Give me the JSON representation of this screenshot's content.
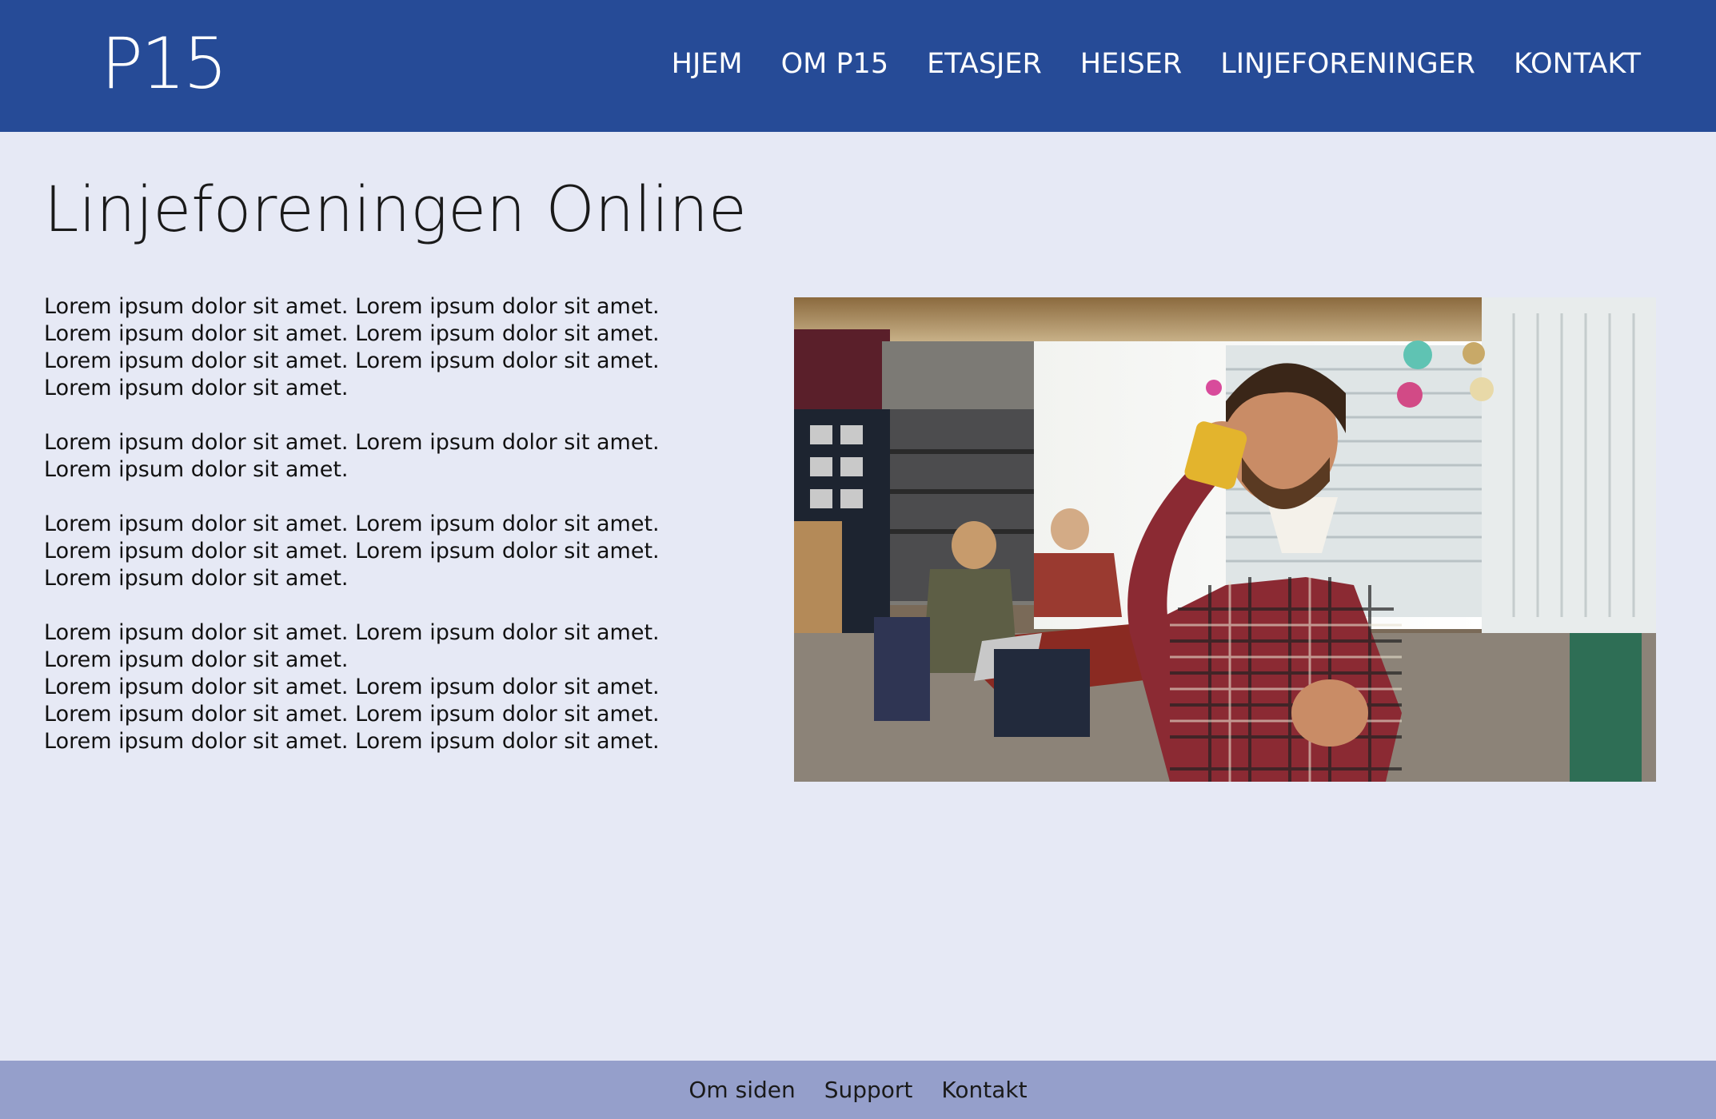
{
  "header": {
    "logo": "P15",
    "nav": [
      "HJEM",
      "OM P15",
      "ETASJER",
      "HEISER",
      "LINJEFORENINGER",
      "KONTAKT"
    ]
  },
  "main": {
    "title": "Linjeforeningen Online",
    "paragraphs": [
      "Lorem ipsum dolor sit amet. Lorem ipsum dolor sit amet. Lorem ipsum dolor sit amet. Lorem ipsum dolor sit amet. Lorem ipsum dolor sit amet. Lorem ipsum dolor sit amet. Lorem ipsum dolor sit amet.",
      "Lorem ipsum dolor sit amet. Lorem ipsum dolor sit amet. Lorem ipsum dolor sit amet.",
      "Lorem ipsum dolor sit amet. Lorem ipsum dolor sit amet. Lorem ipsum dolor sit amet. Lorem ipsum dolor sit amet. Lorem ipsum dolor sit amet.",
      "Lorem ipsum dolor sit amet. Lorem ipsum dolor sit amet. Lorem ipsum dolor sit amet.",
      "Lorem ipsum dolor sit amet. Lorem ipsum dolor sit amet. Lorem ipsum dolor sit amet. Lorem ipsum dolor sit amet. Lorem ipsum dolor sit amet. Lorem ipsum dolor sit amet."
    ]
  },
  "footer": {
    "links": [
      "Om siden",
      "Support",
      "Kontakt"
    ]
  },
  "colors": {
    "header_bg": "#264b97",
    "page_bg": "#e6e9f5",
    "footer_bg": "#959fcb"
  }
}
